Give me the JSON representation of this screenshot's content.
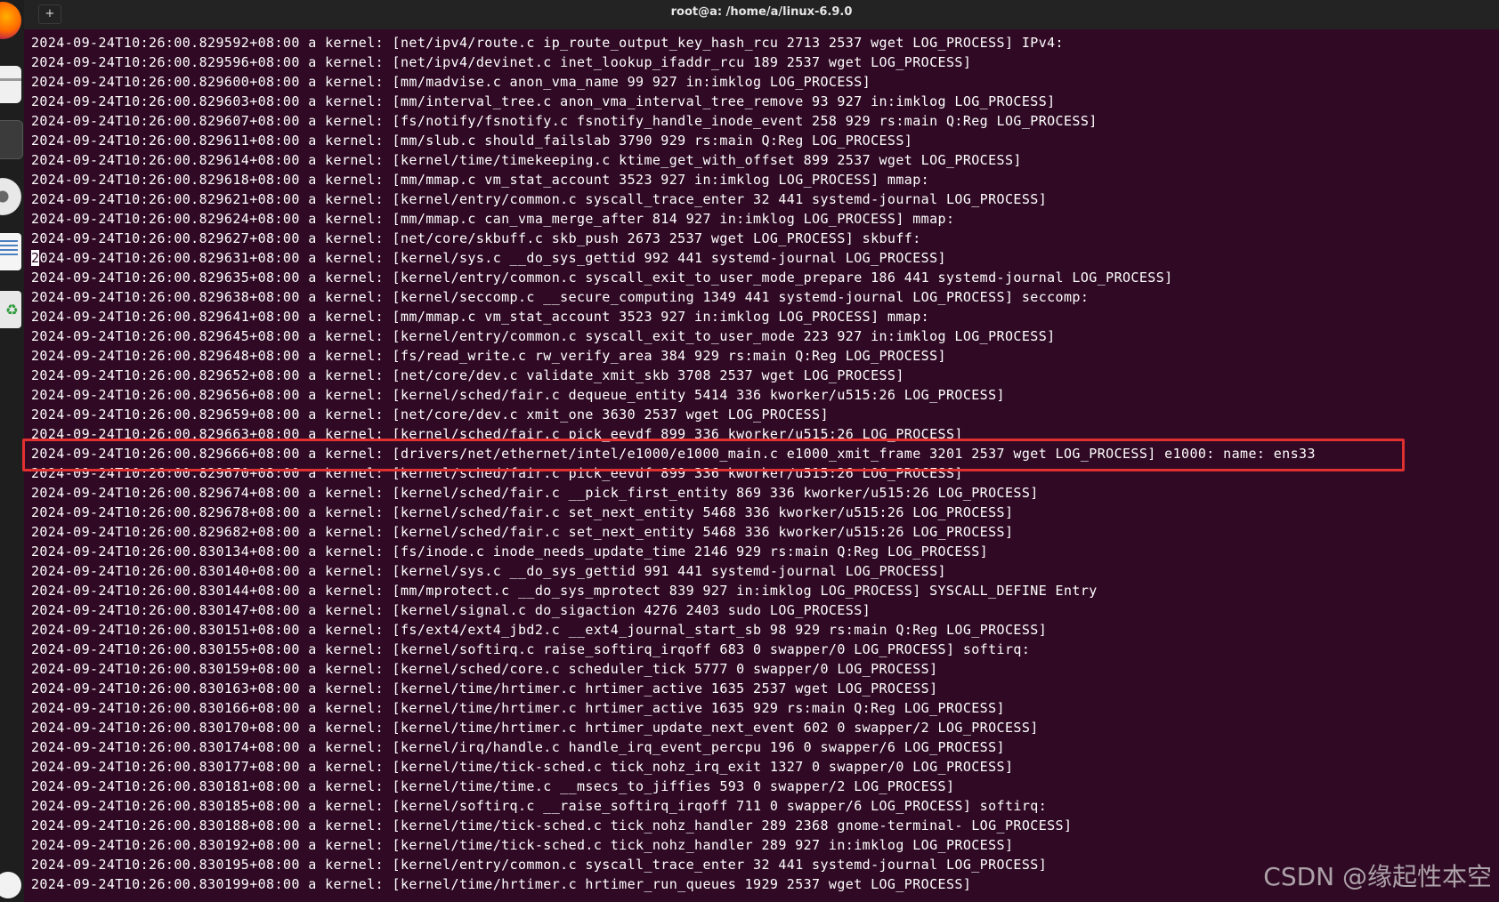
{
  "window": {
    "title": "root@a: /home/a/linux-6.9.0",
    "new_tab_icon": "+"
  },
  "dock": {
    "items": [
      "firefox-icon",
      "files-icon",
      "terminal-icon",
      "disc-icon",
      "text-editor-icon",
      "trash-icon",
      "help-icon"
    ]
  },
  "log_lines": [
    "2024-09-24T10:26:00.829592+08:00 a kernel: [net/ipv4/route.c ip_route_output_key_hash_rcu 2713 2537 wget LOG_PROCESS] IPv4:",
    "2024-09-24T10:26:00.829596+08:00 a kernel: [net/ipv4/devinet.c inet_lookup_ifaddr_rcu 189 2537 wget LOG_PROCESS]",
    "2024-09-24T10:26:00.829600+08:00 a kernel: [mm/madvise.c anon_vma_name 99 927 in:imklog LOG_PROCESS]",
    "2024-09-24T10:26:00.829603+08:00 a kernel: [mm/interval_tree.c anon_vma_interval_tree_remove 93 927 in:imklog LOG_PROCESS]",
    "2024-09-24T10:26:00.829607+08:00 a kernel: [fs/notify/fsnotify.c fsnotify_handle_inode_event 258 929 rs:main Q:Reg LOG_PROCESS]",
    "2024-09-24T10:26:00.829611+08:00 a kernel: [mm/slub.c should_failslab 3790 929 rs:main Q:Reg LOG_PROCESS]",
    "2024-09-24T10:26:00.829614+08:00 a kernel: [kernel/time/timekeeping.c ktime_get_with_offset 899 2537 wget LOG_PROCESS]",
    "2024-09-24T10:26:00.829618+08:00 a kernel: [mm/mmap.c vm_stat_account 3523 927 in:imklog LOG_PROCESS] mmap:",
    "2024-09-24T10:26:00.829621+08:00 a kernel: [kernel/entry/common.c syscall_trace_enter 32 441 systemd-journal LOG_PROCESS]",
    "2024-09-24T10:26:00.829624+08:00 a kernel: [mm/mmap.c can_vma_merge_after 814 927 in:imklog LOG_PROCESS] mmap:",
    "2024-09-24T10:26:00.829627+08:00 a kernel: [net/core/skbuff.c skb_push 2673 2537 wget LOG_PROCESS] skbuff:",
    "2024-09-24T10:26:00.829631+08:00 a kernel: [kernel/sys.c __do_sys_gettid 992 441 systemd-journal LOG_PROCESS]",
    "2024-09-24T10:26:00.829635+08:00 a kernel: [kernel/entry/common.c syscall_exit_to_user_mode_prepare 186 441 systemd-journal LOG_PROCESS]",
    "2024-09-24T10:26:00.829638+08:00 a kernel: [kernel/seccomp.c __secure_computing 1349 441 systemd-journal LOG_PROCESS] seccomp:",
    "2024-09-24T10:26:00.829641+08:00 a kernel: [mm/mmap.c vm_stat_account 3523 927 in:imklog LOG_PROCESS] mmap:",
    "2024-09-24T10:26:00.829645+08:00 a kernel: [kernel/entry/common.c syscall_exit_to_user_mode 223 927 in:imklog LOG_PROCESS]",
    "2024-09-24T10:26:00.829648+08:00 a kernel: [fs/read_write.c rw_verify_area 384 929 rs:main Q:Reg LOG_PROCESS]",
    "2024-09-24T10:26:00.829652+08:00 a kernel: [net/core/dev.c validate_xmit_skb 3708 2537 wget LOG_PROCESS]",
    "2024-09-24T10:26:00.829656+08:00 a kernel: [kernel/sched/fair.c dequeue_entity 5414 336 kworker/u515:26 LOG_PROCESS]",
    "2024-09-24T10:26:00.829659+08:00 a kernel: [net/core/dev.c xmit_one 3630 2537 wget LOG_PROCESS]",
    "2024-09-24T10:26:00.829663+08:00 a kernel: [kernel/sched/fair.c pick_eevdf 899 336 kworker/u515:26 LOG_PROCESS]",
    "2024-09-24T10:26:00.829666+08:00 a kernel: [drivers/net/ethernet/intel/e1000/e1000_main.c e1000_xmit_frame 3201 2537 wget LOG_PROCESS] e1000: name: ens33",
    "2024-09-24T10:26:00.829670+08:00 a kernel: [kernel/sched/fair.c pick_eevdf 899 336 kworker/u515:26 LOG_PROCESS]",
    "2024-09-24T10:26:00.829674+08:00 a kernel: [kernel/sched/fair.c __pick_first_entity 869 336 kworker/u515:26 LOG_PROCESS]",
    "2024-09-24T10:26:00.829678+08:00 a kernel: [kernel/sched/fair.c set_next_entity 5468 336 kworker/u515:26 LOG_PROCESS]",
    "2024-09-24T10:26:00.829682+08:00 a kernel: [kernel/sched/fair.c set_next_entity 5468 336 kworker/u515:26 LOG_PROCESS]",
    "2024-09-24T10:26:00.830134+08:00 a kernel: [fs/inode.c inode_needs_update_time 2146 929 rs:main Q:Reg LOG_PROCESS]",
    "2024-09-24T10:26:00.830140+08:00 a kernel: [kernel/sys.c __do_sys_gettid 991 441 systemd-journal LOG_PROCESS]",
    "2024-09-24T10:26:00.830144+08:00 a kernel: [mm/mprotect.c __do_sys_mprotect 839 927 in:imklog LOG_PROCESS] SYSCALL_DEFINE Entry",
    "2024-09-24T10:26:00.830147+08:00 a kernel: [kernel/signal.c do_sigaction 4276 2403 sudo LOG_PROCESS]",
    "2024-09-24T10:26:00.830151+08:00 a kernel: [fs/ext4/ext4_jbd2.c __ext4_journal_start_sb 98 929 rs:main Q:Reg LOG_PROCESS]",
    "2024-09-24T10:26:00.830155+08:00 a kernel: [kernel/softirq.c raise_softirq_irqoff 683 0 swapper/0 LOG_PROCESS] softirq:",
    "2024-09-24T10:26:00.830159+08:00 a kernel: [kernel/sched/core.c scheduler_tick 5777 0 swapper/0 LOG_PROCESS]",
    "2024-09-24T10:26:00.830163+08:00 a kernel: [kernel/time/hrtimer.c hrtimer_active 1635 2537 wget LOG_PROCESS]",
    "2024-09-24T10:26:00.830166+08:00 a kernel: [kernel/time/hrtimer.c hrtimer_active 1635 929 rs:main Q:Reg LOG_PROCESS]",
    "2024-09-24T10:26:00.830170+08:00 a kernel: [kernel/time/hrtimer.c hrtimer_update_next_event 602 0 swapper/2 LOG_PROCESS]",
    "2024-09-24T10:26:00.830174+08:00 a kernel: [kernel/irq/handle.c handle_irq_event_percpu 196 0 swapper/6 LOG_PROCESS]",
    "2024-09-24T10:26:00.830177+08:00 a kernel: [kernel/time/tick-sched.c tick_nohz_irq_exit 1327 0 swapper/0 LOG_PROCESS]",
    "2024-09-24T10:26:00.830181+08:00 a kernel: [kernel/time/time.c __msecs_to_jiffies 593 0 swapper/2 LOG_PROCESS]",
    "2024-09-24T10:26:00.830185+08:00 a kernel: [kernel/softirq.c __raise_softirq_irqoff 711 0 swapper/6 LOG_PROCESS] softirq:",
    "2024-09-24T10:26:00.830188+08:00 a kernel: [kernel/time/tick-sched.c tick_nohz_handler 289 2368 gnome-terminal- LOG_PROCESS]",
    "2024-09-24T10:26:00.830192+08:00 a kernel: [kernel/time/tick-sched.c tick_nohz_handler 289 927 in:imklog LOG_PROCESS]",
    "2024-09-24T10:26:00.830195+08:00 a kernel: [kernel/entry/common.c syscall_trace_enter 32 441 systemd-journal LOG_PROCESS]",
    "2024-09-24T10:26:00.830199+08:00 a kernel: [kernel/time/hrtimer.c hrtimer_run_queues 1929 2537 wget LOG_PROCESS]"
  ],
  "cursor_line_index": 11,
  "highlighted_line_index": 21,
  "colors": {
    "terminal_bg": "#300a24",
    "highlight_border": "#e03030"
  },
  "watermark": "CSDN @缘起性本空"
}
